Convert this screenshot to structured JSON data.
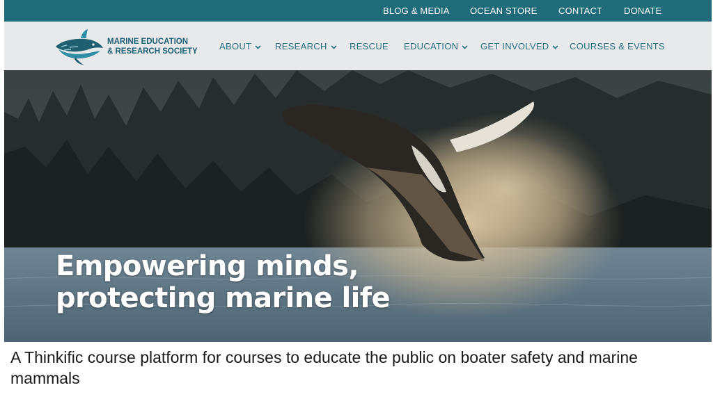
{
  "topbar": {
    "links": [
      "BLOG & MEDIA",
      "OCEAN STORE",
      "CONTACT",
      "DONATE"
    ]
  },
  "brand": {
    "line1": "MARINE EDUCATION",
    "line2": "& RESEARCH SOCIETY",
    "logo_icon": "whale-logo-icon"
  },
  "nav": {
    "items": [
      {
        "label": "ABOUT",
        "has_dropdown": true
      },
      {
        "label": "RESEARCH",
        "has_dropdown": true
      },
      {
        "label": "RESCUE",
        "has_dropdown": false
      },
      {
        "label": "EDUCATION",
        "has_dropdown": true
      },
      {
        "label": "GET INVOLVED",
        "has_dropdown": true
      },
      {
        "label": "COURSES & EVENTS",
        "has_dropdown": false
      }
    ]
  },
  "hero": {
    "line1": "Empowering minds,",
    "line2": "protecting marine life"
  },
  "caption": "A Thinkific course platform for courses to educate the public on boater safety and marine mammals",
  "colors": {
    "topbar": "#206b7a",
    "navbar": "#e7e9eb",
    "brand_text": "#1d5e72",
    "nav_text": "#2a7080"
  }
}
